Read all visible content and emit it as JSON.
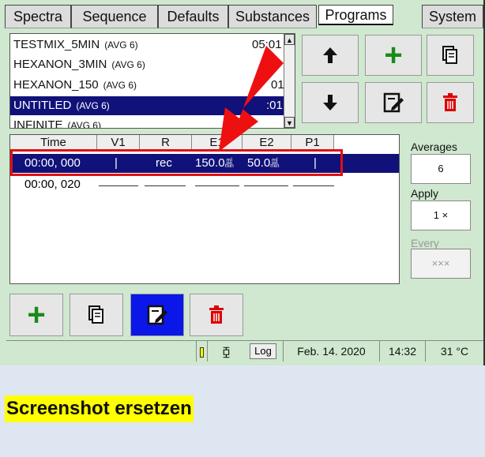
{
  "tabs": [
    "Spectra",
    "Sequence",
    "Defaults",
    "Substances",
    "Programs",
    "System"
  ],
  "active_tab": "Programs",
  "programs": [
    {
      "name": "TESTMIX_5MIN",
      "avg": "(AVG 6)",
      "time": "05:01"
    },
    {
      "name": "HEXANON_3MIN",
      "avg": "(AVG 6)",
      "time": ""
    },
    {
      "name": "HEXANON_150",
      "avg": "(AVG 6)",
      "time": "01"
    },
    {
      "name": "UNTITLED",
      "avg": "(AVG 6)",
      "time": ":01"
    },
    {
      "name": "INFINITE",
      "avg": "(AVG 6)",
      "time": ""
    }
  ],
  "selected_program": "UNTITLED",
  "icons": {
    "up": "arrow-up-icon",
    "down": "arrow-down-icon",
    "add": "plus-icon",
    "copy": "copy-icon",
    "edit": "edit-icon",
    "delete": "trash-icon",
    "scroll_up": "scroll-up-icon",
    "scroll_down": "scroll-down-icon",
    "annotation": "red-arrow-icon"
  },
  "sequence": {
    "columns": [
      "Time",
      "V1",
      "R",
      "E1",
      "E2",
      "P1"
    ],
    "rows": [
      {
        "time": "00:00, 000",
        "v1": "|",
        "r": "rec",
        "e1": "150.0",
        "e2": "50.0",
        "p1": "|"
      },
      {
        "time": "00:00, 020",
        "v1": "",
        "r": "",
        "e1": "",
        "e2": "",
        "p1": ""
      }
    ],
    "flow_unit_num": "ml",
    "flow_unit_den": "min"
  },
  "side": {
    "averages_label": "Averages",
    "averages_value": "6",
    "apply_label": "Apply",
    "apply_value": "1 ×",
    "every_label": "Every",
    "every_value": "×××"
  },
  "status": {
    "plug_glyph": "⧮",
    "log": "Log",
    "date": "Feb. 14. 2020",
    "time": "14:32",
    "temp": "31 °C"
  },
  "note": "Screenshot ersetzen",
  "colors": {
    "app_bg": "#cfe8cf",
    "selected": "#11117a",
    "add_green": "#1a8a1a",
    "delete_red": "#dd0000",
    "edit_active": "#0a17e8",
    "annotation_red": "#e01010",
    "note_bg": "#ffff00"
  }
}
